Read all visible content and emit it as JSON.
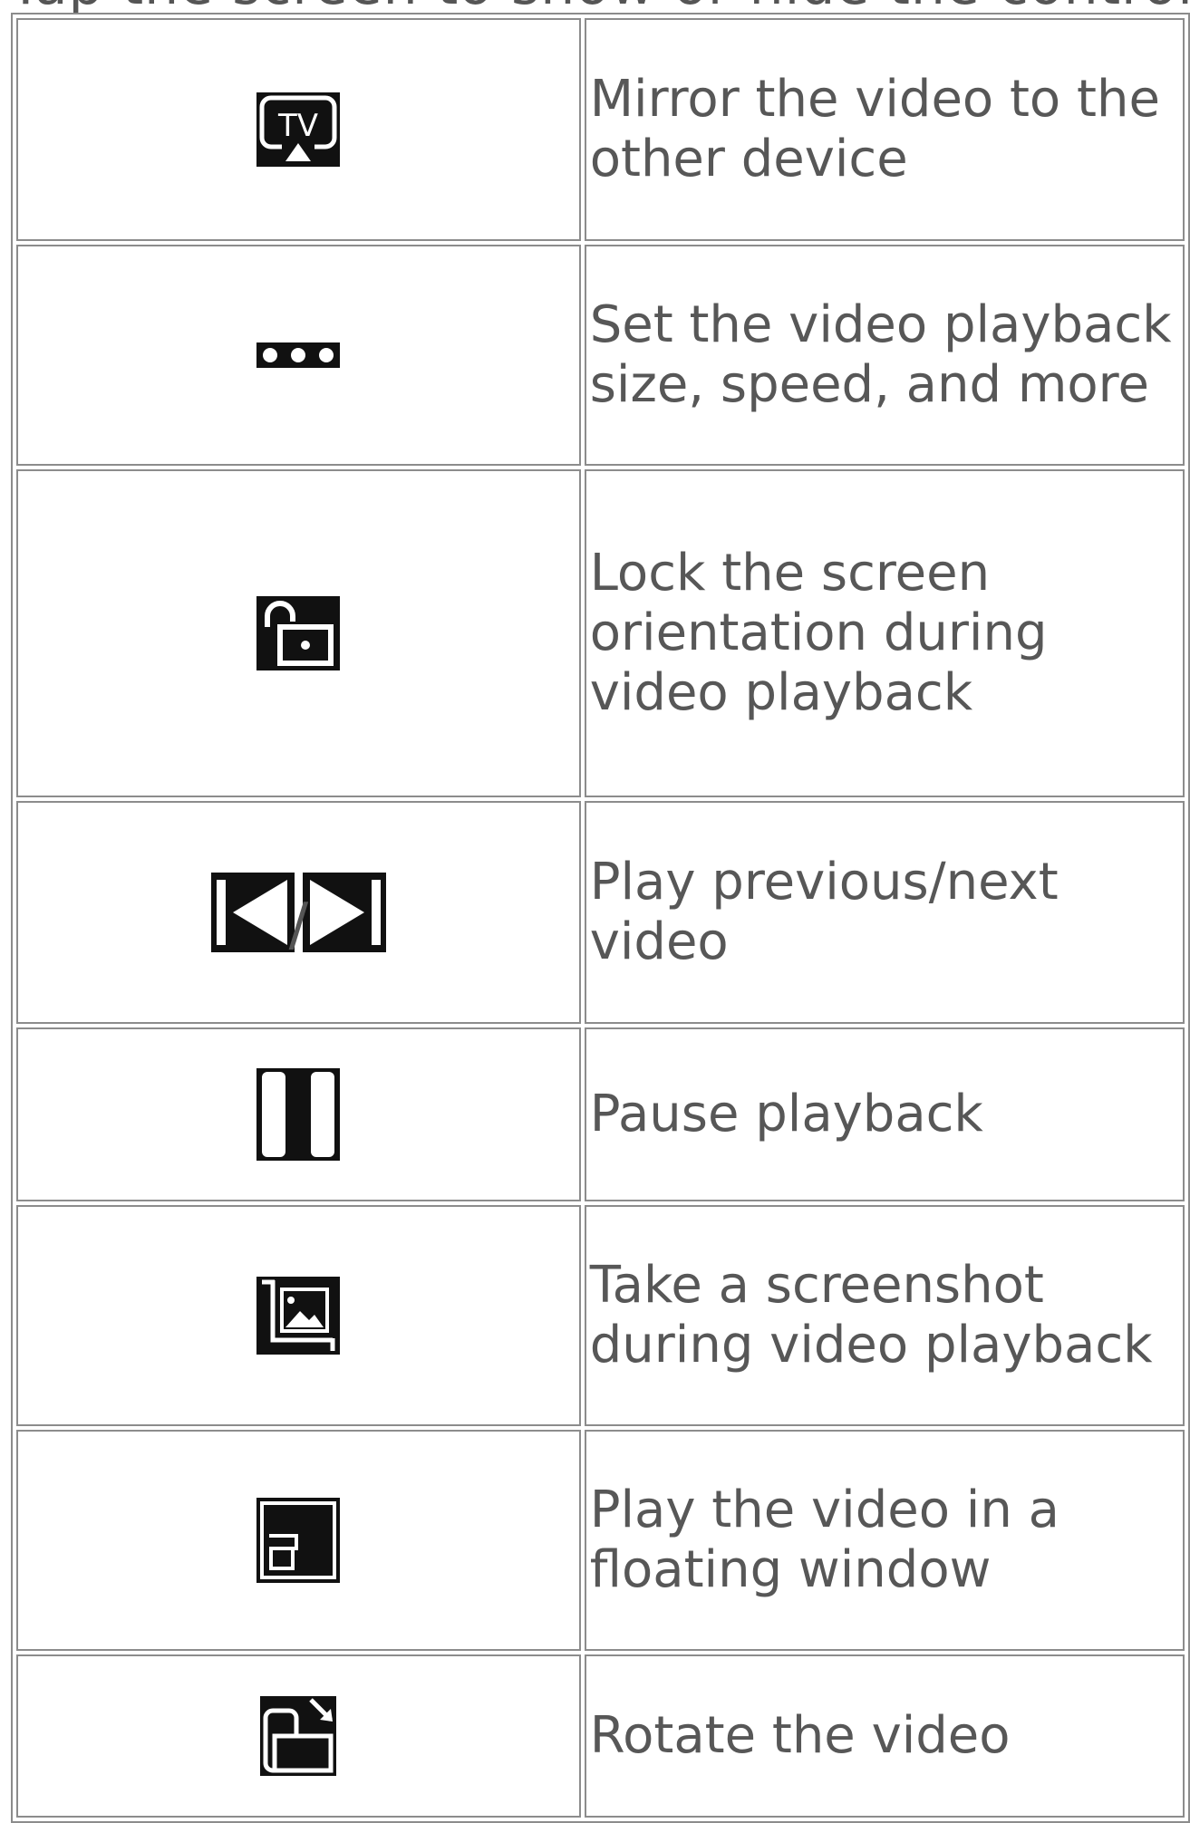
{
  "heading": "Tap the screen to show or hide the controls",
  "rows": [
    {
      "icon": "tv-mirror-icon",
      "description": "Mirror the video to the other device"
    },
    {
      "icon": "more-options-icon",
      "description": "Set the video playback size, speed, and more"
    },
    {
      "icon": "unlock-icon",
      "description": "Lock the screen orientation during video playback"
    },
    {
      "icon": "previous-next-icon",
      "description": "Play previous/next video",
      "separator": "/"
    },
    {
      "icon": "pause-icon",
      "description": "Pause playback"
    },
    {
      "icon": "screenshot-icon",
      "description": "Take a screenshot during video playback"
    },
    {
      "icon": "floating-window-icon",
      "description": "Play the video in a floating window"
    },
    {
      "icon": "rotate-icon",
      "description": "Rotate the video"
    }
  ]
}
